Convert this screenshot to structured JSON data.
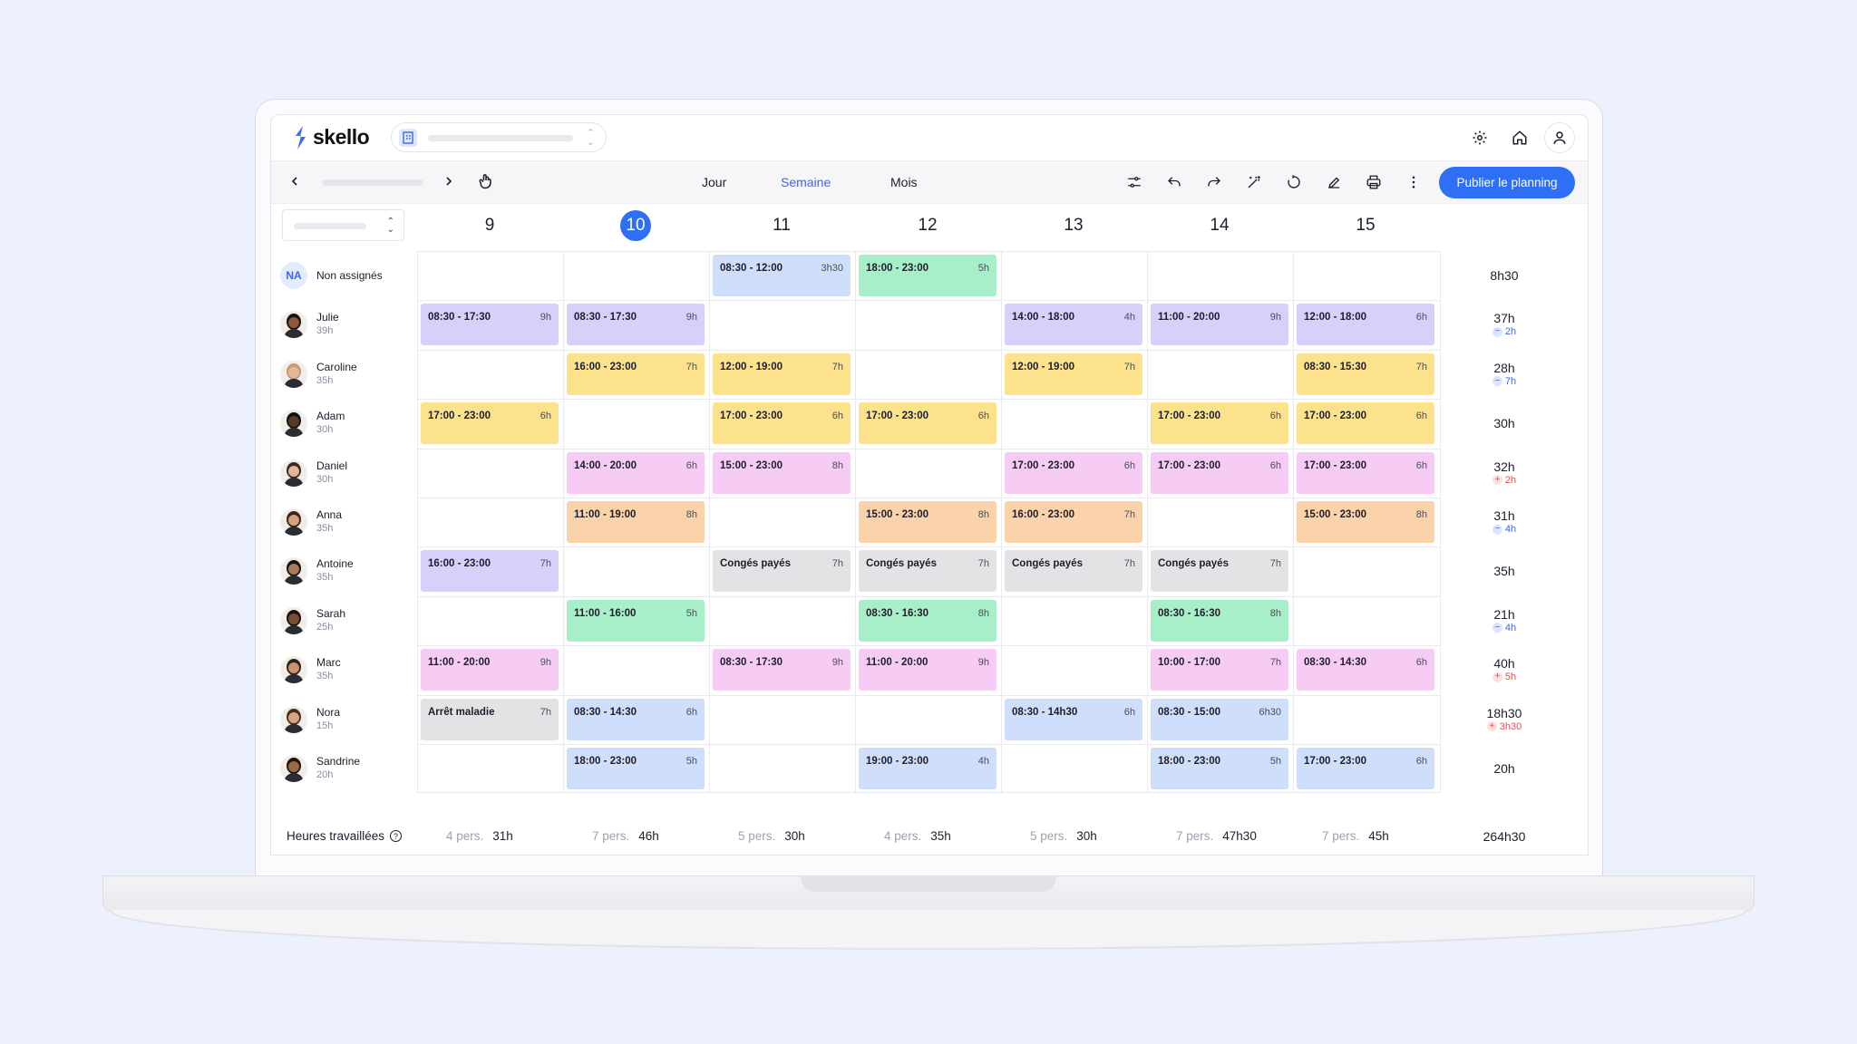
{
  "app": {
    "name": "skello"
  },
  "toolbar": {
    "views": {
      "day": "Jour",
      "week": "Semaine",
      "month": "Mois",
      "active": "Semaine"
    },
    "publish_label": "Publier le planning",
    "accent": "#2f6ff5"
  },
  "days": [
    "9",
    "10",
    "11",
    "12",
    "13",
    "14",
    "15"
  ],
  "today_index": 1,
  "employees": [
    {
      "name": "Non assignés",
      "hours": "",
      "avatar": "NA",
      "total": "8h30",
      "diff": null,
      "diff_type": null,
      "shifts": [
        null,
        null,
        {
          "t": "08:30 - 12:00",
          "d": "3h30",
          "c": "blue"
        },
        {
          "t": "18:00 - 23:00",
          "d": "5h",
          "c": "green"
        },
        null,
        null,
        null
      ]
    },
    {
      "name": "Julie",
      "hours": "39h",
      "avatar": "julie",
      "total": "37h",
      "diff": "2h",
      "diff_type": "minus",
      "shifts": [
        {
          "t": "08:30 - 17:30",
          "d": "9h",
          "c": "purple"
        },
        {
          "t": "08:30 - 17:30",
          "d": "9h",
          "c": "purple"
        },
        null,
        null,
        {
          "t": "14:00 - 18:00",
          "d": "4h",
          "c": "purple"
        },
        {
          "t": "11:00 - 20:00",
          "d": "9h",
          "c": "purple"
        },
        {
          "t": "12:00 - 18:00",
          "d": "6h",
          "c": "purple"
        }
      ]
    },
    {
      "name": "Caroline",
      "hours": "35h",
      "avatar": "caroline",
      "total": "28h",
      "diff": "7h",
      "diff_type": "minus",
      "shifts": [
        null,
        {
          "t": "16:00 - 23:00",
          "d": "7h",
          "c": "yellow"
        },
        {
          "t": "12:00 - 19:00",
          "d": "7h",
          "c": "yellow"
        },
        null,
        {
          "t": "12:00 - 19:00",
          "d": "7h",
          "c": "yellow"
        },
        null,
        {
          "t": "08:30 - 15:30",
          "d": "7h",
          "c": "yellow"
        }
      ]
    },
    {
      "name": "Adam",
      "hours": "30h",
      "avatar": "adam",
      "total": "30h",
      "diff": null,
      "diff_type": null,
      "shifts": [
        {
          "t": "17:00 - 23:00",
          "d": "6h",
          "c": "yellow"
        },
        null,
        {
          "t": "17:00 - 23:00",
          "d": "6h",
          "c": "yellow"
        },
        {
          "t": "17:00 - 23:00",
          "d": "6h",
          "c": "yellow"
        },
        null,
        {
          "t": "17:00 - 23:00",
          "d": "6h",
          "c": "yellow"
        },
        {
          "t": "17:00 - 23:00",
          "d": "6h",
          "c": "yellow"
        }
      ]
    },
    {
      "name": "Daniel",
      "hours": "30h",
      "avatar": "daniel",
      "total": "32h",
      "diff": "2h",
      "diff_type": "plus",
      "shifts": [
        null,
        {
          "t": "14:00 - 20:00",
          "d": "6h",
          "c": "pink"
        },
        {
          "t": "15:00 - 23:00",
          "d": "8h",
          "c": "pink"
        },
        null,
        {
          "t": "17:00 - 23:00",
          "d": "6h",
          "c": "pink"
        },
        {
          "t": "17:00 - 23:00",
          "d": "6h",
          "c": "pink"
        },
        {
          "t": "17:00 - 23:00",
          "d": "6h",
          "c": "pink"
        }
      ]
    },
    {
      "name": "Anna",
      "hours": "35h",
      "avatar": "anna",
      "total": "31h",
      "diff": "4h",
      "diff_type": "minus",
      "shifts": [
        null,
        {
          "t": "11:00 - 19:00",
          "d": "8h",
          "c": "orange"
        },
        null,
        {
          "t": "15:00 - 23:00",
          "d": "8h",
          "c": "orange"
        },
        {
          "t": "16:00 - 23:00",
          "d": "7h",
          "c": "orange"
        },
        null,
        {
          "t": "15:00 - 23:00",
          "d": "8h",
          "c": "orange"
        }
      ]
    },
    {
      "name": "Antoine",
      "hours": "35h",
      "avatar": "antoine",
      "total": "35h",
      "diff": null,
      "diff_type": null,
      "shifts": [
        {
          "t": "16:00 - 23:00",
          "d": "7h",
          "c": "purple"
        },
        null,
        {
          "t": "Congés payés",
          "d": "7h",
          "c": "grey"
        },
        {
          "t": "Congés payés",
          "d": "7h",
          "c": "grey"
        },
        {
          "t": "Congés payés",
          "d": "7h",
          "c": "grey"
        },
        {
          "t": "Congés payés",
          "d": "7h",
          "c": "grey"
        },
        null
      ]
    },
    {
      "name": "Sarah",
      "hours": "25h",
      "avatar": "sarah",
      "total": "21h",
      "diff": "4h",
      "diff_type": "minus",
      "shifts": [
        null,
        {
          "t": "11:00 - 16:00",
          "d": "5h",
          "c": "green"
        },
        null,
        {
          "t": "08:30 - 16:30",
          "d": "8h",
          "c": "green"
        },
        null,
        {
          "t": "08:30 - 16:30",
          "d": "8h",
          "c": "green"
        },
        null
      ]
    },
    {
      "name": "Marc",
      "hours": "35h",
      "avatar": "marc",
      "total": "40h",
      "diff": "5h",
      "diff_type": "plus",
      "shifts": [
        {
          "t": "11:00 - 20:00",
          "d": "9h",
          "c": "pink"
        },
        null,
        {
          "t": "08:30 - 17:30",
          "d": "9h",
          "c": "pink"
        },
        {
          "t": "11:00 - 20:00",
          "d": "9h",
          "c": "pink"
        },
        null,
        {
          "t": "10:00 - 17:00",
          "d": "7h",
          "c": "pink"
        },
        {
          "t": "08:30 - 14:30",
          "d": "6h",
          "c": "pink"
        }
      ]
    },
    {
      "name": "Nora",
      "hours": "15h",
      "avatar": "nora",
      "total": "18h30",
      "diff": "3h30",
      "diff_type": "plus",
      "shifts": [
        {
          "t": "Arrêt maladie",
          "d": "7h",
          "c": "grey"
        },
        {
          "t": "08:30 - 14:30",
          "d": "6h",
          "c": "blue"
        },
        null,
        null,
        {
          "t": "08:30 - 14h30",
          "d": "6h",
          "c": "blue"
        },
        {
          "t": "08:30 - 15:00",
          "d": "6h30",
          "c": "blue"
        },
        null
      ]
    },
    {
      "name": "Sandrine",
      "hours": "20h",
      "avatar": "sandrine",
      "total": "20h",
      "diff": null,
      "diff_type": null,
      "shifts": [
        null,
        {
          "t": "18:00 - 23:00",
          "d": "5h",
          "c": "blue"
        },
        null,
        {
          "t": "19:00 - 23:00",
          "d": "4h",
          "c": "blue"
        },
        null,
        {
          "t": "18:00 - 23:00",
          "d": "5h",
          "c": "blue"
        },
        {
          "t": "17:00 - 23:00",
          "d": "6h",
          "c": "blue"
        }
      ]
    }
  ],
  "footer": {
    "label": "Heures travaillées",
    "days": [
      {
        "people": "4 pers.",
        "hours": "31h"
      },
      {
        "people": "7 pers.",
        "hours": "46h"
      },
      {
        "people": "5 pers.",
        "hours": "30h"
      },
      {
        "people": "4 pers.",
        "hours": "35h"
      },
      {
        "people": "5 pers.",
        "hours": "30h"
      },
      {
        "people": "7 pers.",
        "hours": "47h30"
      },
      {
        "people": "7 pers.",
        "hours": "45h"
      }
    ],
    "grand_total": "264h30"
  },
  "icons": {
    "settings": "gear-icon",
    "home": "home-icon",
    "user": "user-icon",
    "prev": "chevron-left-icon",
    "next": "chevron-right-icon",
    "hand": "hand-pointer-icon",
    "tools": [
      "sliders-icon",
      "undo-icon",
      "redo-icon",
      "magic-wand-icon",
      "history-icon",
      "edit-icon",
      "print-icon",
      "more-vertical-icon"
    ]
  }
}
